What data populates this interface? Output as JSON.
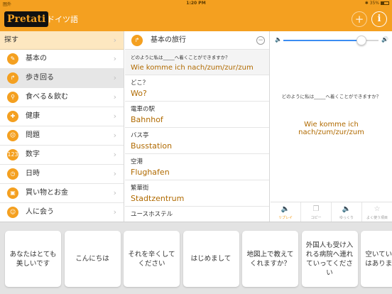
{
  "status": {
    "carrier": "圏外",
    "time": "1:20 PM",
    "battery": "35%"
  },
  "header": {
    "logo": "Pretati",
    "language": "ドイツ語",
    "add_symbol": "+",
    "info_symbol": "i"
  },
  "categories": {
    "header": "探す",
    "items": [
      {
        "label": "基本の",
        "icon": "broom-icon",
        "glyph": "✎"
      },
      {
        "label": "歩き回る",
        "icon": "walk-arrow-icon",
        "glyph": "↱"
      },
      {
        "label": "食べる＆飲む",
        "icon": "fork-knife-icon",
        "glyph": "⚲"
      },
      {
        "label": "健康",
        "icon": "health-icon",
        "glyph": "✚"
      },
      {
        "label": "問題",
        "icon": "sad-face-icon",
        "glyph": "☹"
      },
      {
        "label": "数字",
        "icon": "numbers-icon",
        "glyph": "123"
      },
      {
        "label": "日時",
        "icon": "clock-icon",
        "glyph": "◷"
      },
      {
        "label": "買い物とお金",
        "icon": "shopping-bag-icon",
        "glyph": "▣"
      },
      {
        "label": "人に会う",
        "icon": "people-icon",
        "glyph": "☺"
      }
    ]
  },
  "phrases": {
    "title": "基本の旅行",
    "items": [
      {
        "jp": "どのように私は_____へ着くことができますか？",
        "de": "Wie komme ich nach/zum/zur/zum"
      },
      {
        "jp": "どこ？",
        "de": "Wo?"
      },
      {
        "jp": "電車の駅",
        "de": "Bahnhof"
      },
      {
        "jp": "バス亭",
        "de": "Busstation"
      },
      {
        "jp": "空港",
        "de": "Flughafen"
      },
      {
        "jp": "繁華街",
        "de": "Stadtzentrum"
      },
      {
        "jp": "ユースホステル",
        "de": ""
      }
    ]
  },
  "detail": {
    "volume_level": 0.82,
    "jp": "どのように私は_____へ着くことができますか？",
    "de": "Wie komme ich nach/zum/zur/zum",
    "actions": [
      {
        "label": "リプレイ",
        "icon": "speaker-icon",
        "glyph": "🔈"
      },
      {
        "label": "コピー",
        "icon": "copy-icon",
        "glyph": "❐"
      },
      {
        "label": "ゆっくり",
        "icon": "slow-speaker-icon",
        "glyph": "🔈"
      },
      {
        "label": "よく使う項目",
        "icon": "star-icon",
        "glyph": "☆"
      }
    ]
  },
  "quick_phrases": [
    "あなたはとても美しいです",
    "こんにちは",
    "それを辛くしてください",
    "はじめまして",
    "地図上で教えてくれますか？",
    "外国人も受け入れる病院へ連れていってください",
    "空いている部屋はありますか？"
  ],
  "colors": {
    "accent": "#f4a020",
    "german_text": "#b06a00",
    "selected_header": "#fde7c0"
  }
}
